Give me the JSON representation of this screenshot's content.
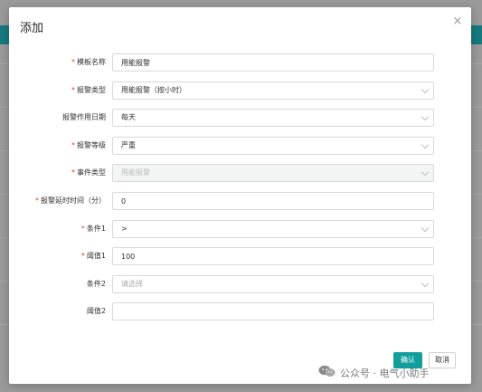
{
  "dialog": {
    "title": "添加",
    "close_glyph": "×"
  },
  "form": {
    "fields": [
      {
        "label": "模板名称",
        "required": true,
        "type": "input",
        "value": "用能报警"
      },
      {
        "label": "报警类型",
        "required": true,
        "type": "select",
        "value": "用能报警（按小时）"
      },
      {
        "label": "报警作用日期",
        "required": false,
        "type": "select",
        "value": "每天"
      },
      {
        "label": "报警等级",
        "required": true,
        "type": "select",
        "value": "严重"
      },
      {
        "label": "事件类型",
        "required": true,
        "type": "select",
        "value": "用能报警",
        "disabled": true
      },
      {
        "label": "报警延时时间（分）",
        "required": true,
        "type": "input",
        "value": "0"
      },
      {
        "label": "条件1",
        "required": true,
        "type": "select",
        "value": ">"
      },
      {
        "label": "阈值1",
        "required": true,
        "type": "input",
        "value": "100"
      },
      {
        "label": "条件2",
        "required": false,
        "type": "select",
        "value": "",
        "placeholder": "请选择"
      },
      {
        "label": "阈值2",
        "required": false,
        "type": "input",
        "value": ""
      }
    ],
    "required_mark": "*"
  },
  "buttons": {
    "confirm": "确认",
    "cancel": "取消"
  },
  "watermark": {
    "text": "公众号 · 电气小助手",
    "icon": "wechat-icon"
  },
  "colors": {
    "primary": "#139e9c",
    "background_band": "#167a7d",
    "required": "#e0463c"
  }
}
